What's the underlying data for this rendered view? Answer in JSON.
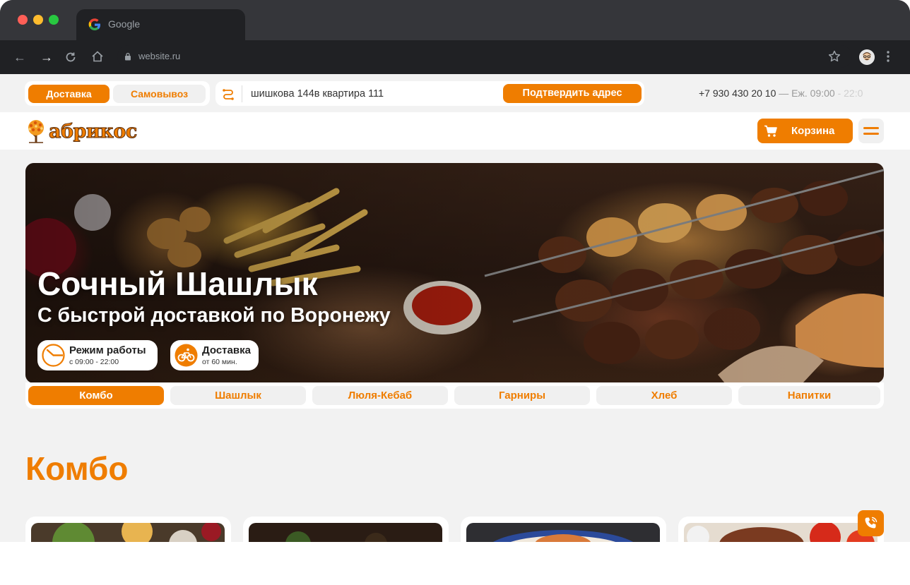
{
  "browser": {
    "tab_title": "Google",
    "url": "website.ru",
    "icons": [
      "back-icon",
      "forward-icon",
      "reload-icon",
      "home-icon",
      "lock-icon",
      "star-icon",
      "profile-avatar",
      "menu-icon"
    ]
  },
  "topbar": {
    "delivery_label": "Доставка",
    "pickup_label": "Самовывоз",
    "address_value": "шишкова 144в квартира 111",
    "confirm_label": "Подтвердить адрес",
    "phone": "+7 930 430 20 10",
    "hours_sep": " — ",
    "hours_prefix": "Еж. 09:00",
    "hours_suffix": " - 22:0"
  },
  "header": {
    "logo_text": "абрикос",
    "cart_label": "Корзина"
  },
  "hero": {
    "title": "Сочный Шашлык",
    "subtitle": "С быстрой доставкой по Воронежу",
    "hours_title": "Режим работы",
    "hours_value": "с 09:00 - 22:00",
    "delivery_title": "Доставка",
    "delivery_value": "от 60 мин."
  },
  "categories": [
    {
      "label": "Комбо",
      "active": true
    },
    {
      "label": "Шашлык",
      "active": false
    },
    {
      "label": "Люля-Кебаб",
      "active": false
    },
    {
      "label": "Гарниры",
      "active": false
    },
    {
      "label": "Хлеб",
      "active": false
    },
    {
      "label": "Напитки",
      "active": false
    }
  ],
  "section": {
    "title": "Комбо"
  },
  "colors": {
    "accent": "#ef7d00",
    "background": "#f2f2f2",
    "chrome_dark": "#202124"
  }
}
